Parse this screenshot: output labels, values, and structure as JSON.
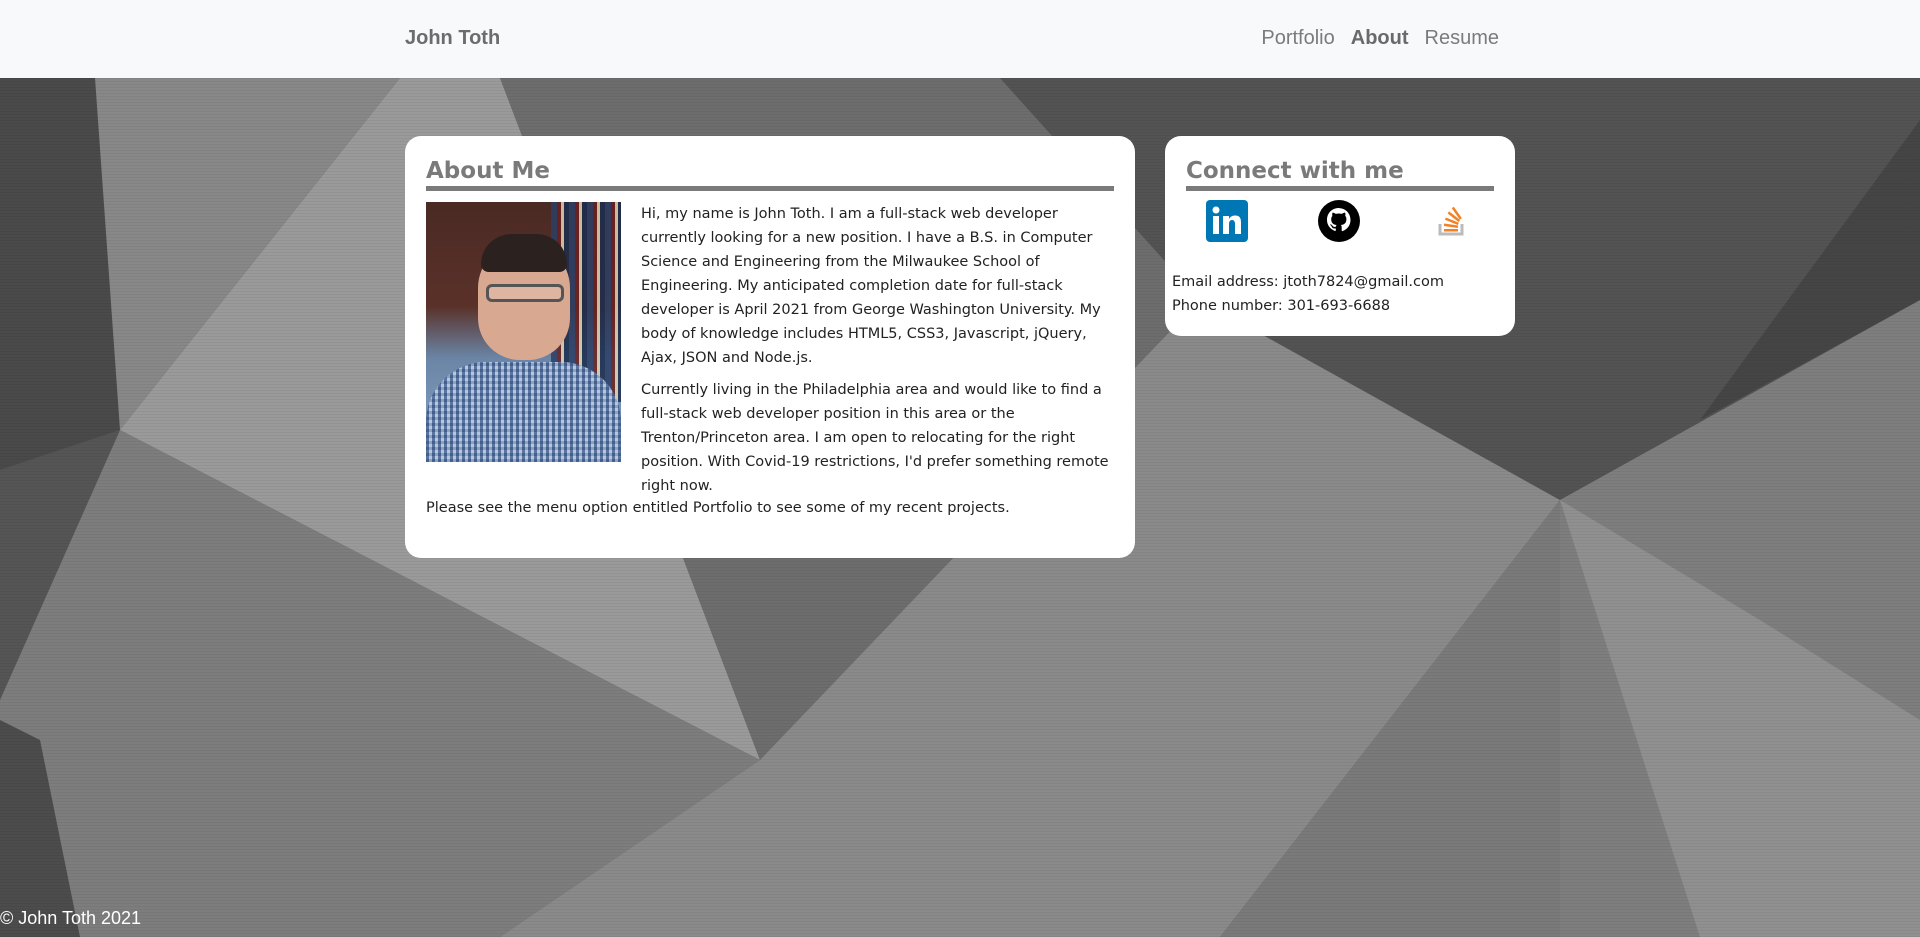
{
  "navbar": {
    "brand": "John Toth",
    "links": [
      {
        "label": "Portfolio",
        "active": false
      },
      {
        "label": "About",
        "active": true
      },
      {
        "label": "Resume",
        "active": false
      }
    ]
  },
  "about": {
    "title": "About Me",
    "photo_alt": "Photo of John Toth",
    "paragraphs": [
      "Hi, my name is John Toth. I am a full-stack web developer currently looking for a new position. I have a B.S. in Computer Science and Engineering from the Milwaukee School of Engineering. My anticipated completion date for full-stack developer is April 2021 from George Washington University. My body of knowledge includes HTML5, CSS3, Javascript, jQuery, Ajax, JSON and Node.js.",
      "Currently living in the Philadelphia area and would like to find a full-stack web developer position in this area or the Trenton/Princeton area. I am open to relocating for the right position. With Covid-19 restrictions, I'd prefer something remote right now."
    ],
    "footer_text": "Please see the menu option entitled Portfolio to see some of my recent projects."
  },
  "connect": {
    "title": "Connect with me",
    "social": [
      {
        "name": "linkedin-icon",
        "color": "#0077b5"
      },
      {
        "name": "github-icon",
        "color": "#000000"
      },
      {
        "name": "stackoverflow-icon",
        "color": "#f48024"
      }
    ],
    "email": "Email address: jtoth7824@gmail.com",
    "phone": "Phone number: 301-693-6688"
  },
  "footer": {
    "copyright": "© John Toth 2021"
  },
  "colors": {
    "navbar_bg": "#f8f9fa",
    "card_bg": "#ffffff",
    "heading": "#7a7a7a",
    "background": "#6f6f6f"
  }
}
